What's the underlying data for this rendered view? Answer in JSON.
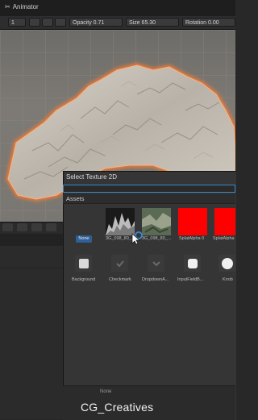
{
  "header": {
    "animator_tab": "Animator"
  },
  "toolbar": {
    "field_value": "1",
    "opacity_label": "Opacity 0.71",
    "size_label": "Size 65.30",
    "rotation_label": "Rotation 0.00"
  },
  "picker": {
    "title": "Select Texture 2D",
    "search_placeholder": "",
    "assets_label": "Assets",
    "none_badge": "None",
    "textures": [
      {
        "label": "3G_098_80_...",
        "kind": "height"
      },
      {
        "label": "3G_098_80_...",
        "kind": "foliage"
      },
      {
        "label": "SplatAlpha 0",
        "kind": "red"
      },
      {
        "label": "SplatAlpha",
        "kind": "red"
      }
    ],
    "sprites": [
      {
        "label": "Background",
        "icon": "rounded-square-icon"
      },
      {
        "label": "Checkmark",
        "icon": "checkmark-icon"
      },
      {
        "label": "DropdownA...",
        "icon": "chevron-down-icon"
      },
      {
        "label": "InputFieldB...",
        "icon": "rounded-square-icon"
      },
      {
        "label": "Knob",
        "icon": "circle-icon"
      }
    ],
    "footer_none": "None"
  },
  "watermark": "CG_Creatives",
  "colors": {
    "accent": "#3a86c8",
    "selection": "#2f5f96",
    "terrain_outline": "#ff7a2e",
    "splat_red": "#ff0000"
  }
}
